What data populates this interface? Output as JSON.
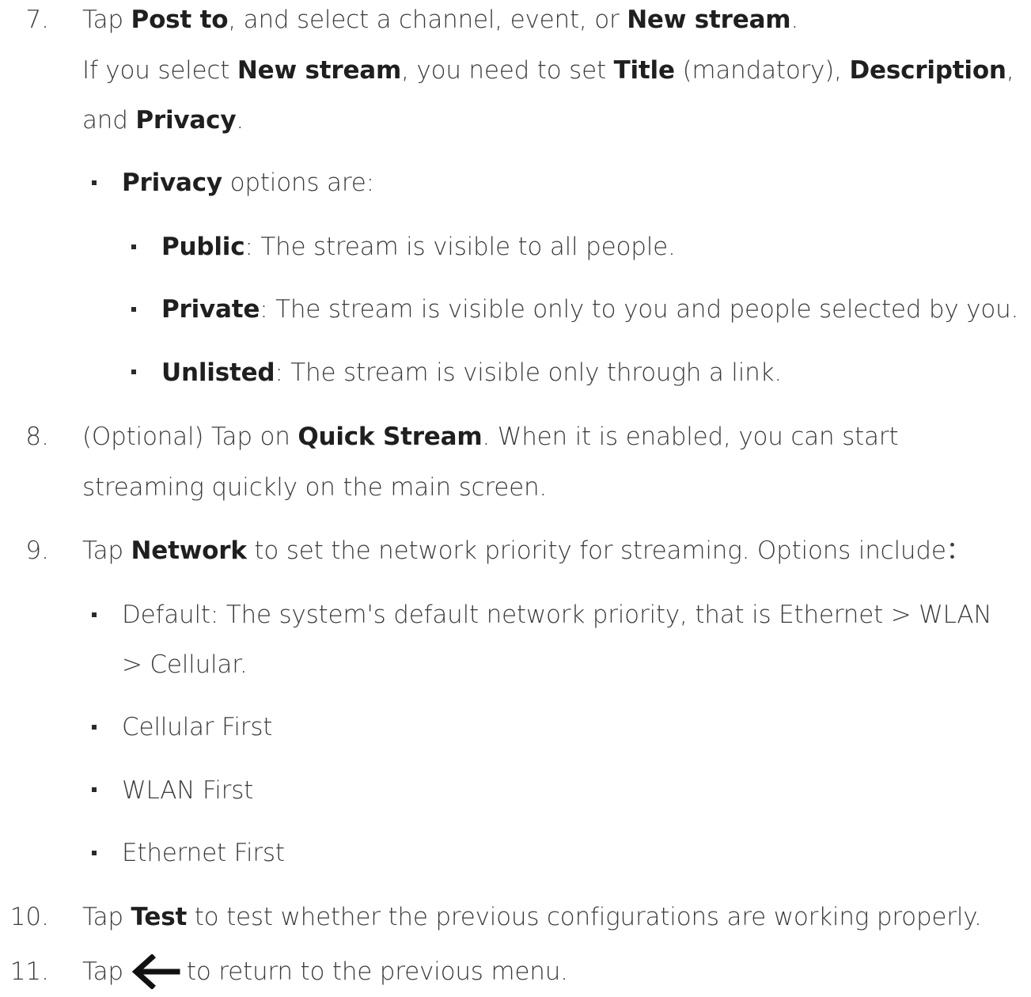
{
  "steps": {
    "s7": {
      "number": "7.",
      "l1_a": "Tap ",
      "l1_b": "Post to",
      "l1_c": ", and select a channel, event, or ",
      "l1_d": "New stream",
      "l1_e": ".",
      "l2_a": "If you select ",
      "l2_b": "New stream",
      "l2_c": ", you need to set ",
      "l2_d": "Title",
      "l2_e": " (mandatory), ",
      "l2_f": "Description",
      "l2_g": ",",
      "l3_a": "and ",
      "l3_b": "Privacy",
      "l3_c": ".",
      "privacy_label": "Privacy",
      "privacy_rest": " options are:",
      "options": [
        {
          "name": "Public",
          "text": ": The stream is visible to all people."
        },
        {
          "name": "Private",
          "text": ": The stream is visible only to you and people selected by you."
        },
        {
          "name": "Unlisted",
          "text": ": The stream is visible only through a link."
        }
      ]
    },
    "s8": {
      "number": "8.",
      "l1_a": "(Optional) Tap on ",
      "l1_b": "Quick Stream",
      "l1_c": ". When it is enabled, you can start",
      "l2": "streaming quickly on the main screen."
    },
    "s9": {
      "number": "9.",
      "l1_a": "Tap ",
      "l1_b": "Network",
      "l1_c": " to set the network priority for streaming. Options include：",
      "opt1_l1": "Default: The system's default network priority, that is Ethernet > WLAN",
      "opt1_l2": "> Cellular.",
      "opt2": "Cellular First",
      "opt3": "WLAN First",
      "opt4": "Ethernet First"
    },
    "s10": {
      "number": "10.",
      "a": "Tap ",
      "b": "Test",
      "c": " to test whether the previous configurations are working properly."
    },
    "s11": {
      "number": "11.",
      "a": "Tap",
      "icon": "back-arrow-icon",
      "c": "to return to the previous menu."
    }
  }
}
